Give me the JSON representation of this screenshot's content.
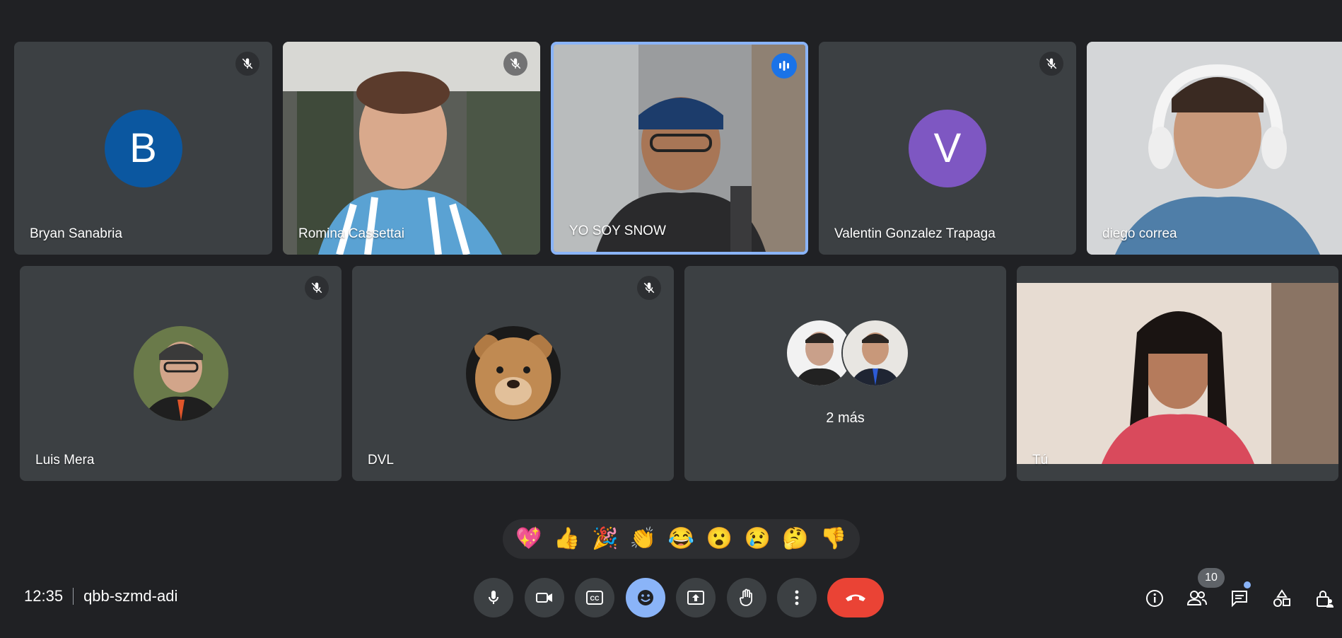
{
  "participants": [
    {
      "name": "Bryan Sanabria",
      "initial": "B",
      "avatar_color": "#0b57a0",
      "muted": true
    },
    {
      "name": "Romina Cassettai",
      "muted": true
    },
    {
      "name": "YO SOY SNOW",
      "speaking": true
    },
    {
      "name": "Valentin Gonzalez Trapaga",
      "initial": "V",
      "avatar_color": "#7e57c2",
      "muted": true
    },
    {
      "name": "diego correa"
    },
    {
      "name": "Luis Mera",
      "muted": true
    },
    {
      "name": "DVL",
      "muted": true
    },
    {
      "more_label": "2 más"
    },
    {
      "name": "Tú"
    }
  ],
  "reactions": [
    "💖",
    "👍",
    "🎉",
    "👏",
    "😂",
    "😮",
    "😢",
    "🤔",
    "👎"
  ],
  "meeting": {
    "time": "12:35",
    "code": "qbb-szmd-adi"
  },
  "people_count": "10",
  "colors": {
    "end_call": "#ea4335",
    "accent": "#8ab4f8",
    "tile": "#3c4043",
    "background": "#202124"
  }
}
